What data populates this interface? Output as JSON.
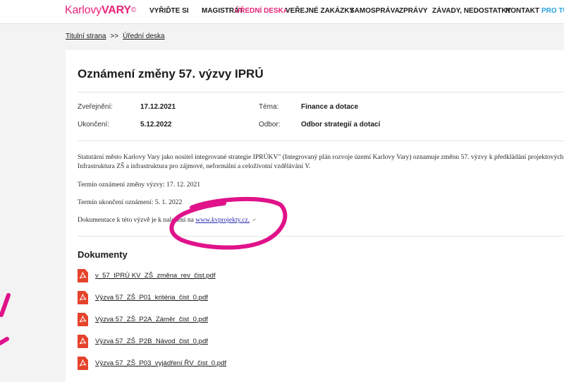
{
  "header": {
    "logo_part1": "Karlovy",
    "logo_part2": "VARY",
    "logo_mark": "©",
    "nav": [
      {
        "label": "VYŘIĎTE SI"
      },
      {
        "label": "MAGISTRÁT"
      },
      {
        "label": "ÚŘEDNÍ DESKA"
      },
      {
        "label": "VEŘEJNÉ ZAKÁZKY"
      },
      {
        "label": "SAMOSPRÁVA"
      },
      {
        "label": "ZPRÁVY"
      },
      {
        "label": "ZÁVADY, NEDOSTATKY"
      },
      {
        "label": "KONTAKT"
      },
      {
        "label": "PRO TURISTY"
      }
    ],
    "colors": {
      "brand": "#e7257b",
      "accent": "#27a2e0"
    }
  },
  "breadcrumb": {
    "home": "Titulní strana",
    "separator": ">>",
    "current": "Úřední deska"
  },
  "notice": {
    "title": "Oznámení změny 57. výzvy IPRÚ",
    "published_label": "Zveřejnění:",
    "published_value": "17.12.2021",
    "ended_label": "Ukončení:",
    "ended_value": "5.12.2022",
    "topic_label": "Téma:",
    "topic_value": "Finance a dotace",
    "dept_label": "Odbor:",
    "dept_value": "Odbor strategií a dotací",
    "body_line1": "Statutární město Karlovy Vary jako nositel integrované strategie IPRÚKV\" (Integrovaný plán rozvoje území Karlovy Vary) oznamuje změnu 57. výzvy k předkládání projektových",
    "body_line2": "Infrastruktura ZŠ a infrastruktura pro zájmové, neformální a celoživotní vzdělávání V.",
    "announce_date": "Termín oznámení změny výzvy: 17. 12. 2021",
    "end_date": "Termín ukončení oznámení:  5. 1. 2022",
    "docs_text": "Dokumentace k této výzvě je k nalezení na ",
    "docs_link": "www.kvprojekty.cz.",
    "ext_icon": "external-link-icon"
  },
  "documents": {
    "title": "Dokumenty",
    "icon": "pdf-icon",
    "files": [
      {
        "name": "v_57_IPRÚ KV_ZŠ_změna_rev_čist.pdf"
      },
      {
        "name": "Výzva 57_ZŠ_P01_kritéria_čist_0.pdf"
      },
      {
        "name": "Výzva 57_ZŠ_P2A_Záměr_čist_0.pdf"
      },
      {
        "name": "Výzva 57_ZŠ_P2B_Návod_čist_0.pdf"
      },
      {
        "name": "Výzva 57_ZŠ_P03_vyjádření ŘV_čist_0.pdf"
      }
    ]
  },
  "annotation_color": "#e0128a"
}
